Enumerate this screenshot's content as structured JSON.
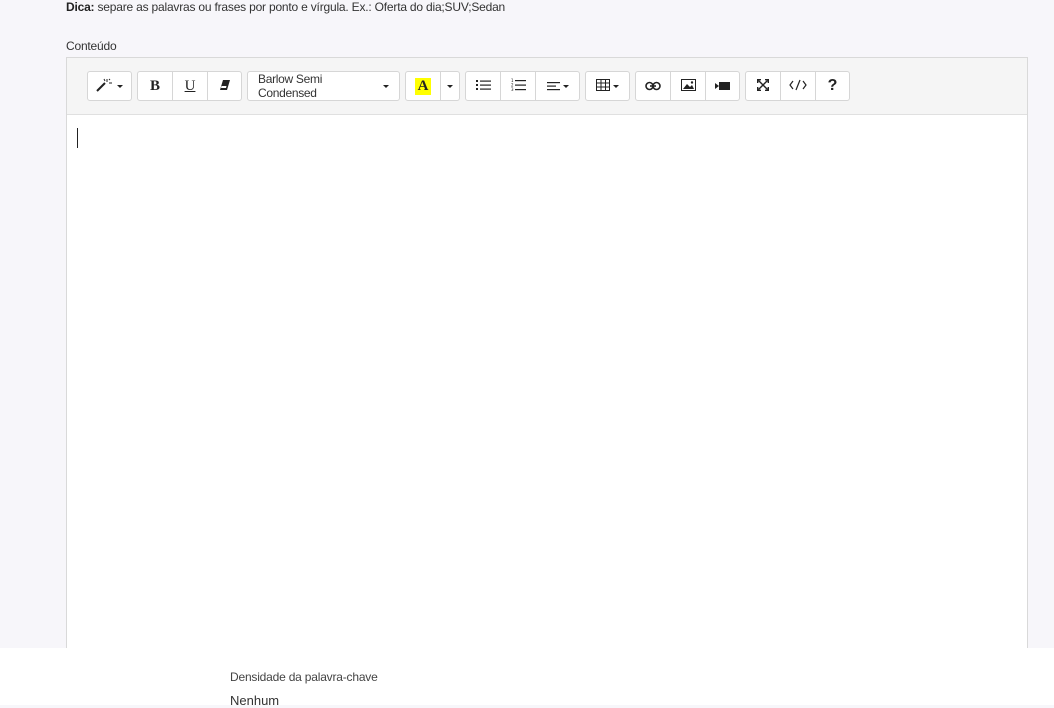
{
  "hint": {
    "label": "Dica:",
    "text": " separe as palavras ou frases por ponto e vírgula. Ex.: Oferta do dia;SUV;Sedan"
  },
  "content": {
    "label": "Conteúdo"
  },
  "toolbar": {
    "font_name": "Barlow Semi Condensed",
    "bold": "B",
    "underline": "U",
    "help": "?"
  },
  "icons": [
    "magic-icon",
    "bold-icon",
    "underline-icon",
    "eraser-icon",
    "font-color-icon",
    "unordered-list-icon",
    "ordered-list-icon",
    "align-icon",
    "table-icon",
    "link-icon",
    "image-icon",
    "video-icon",
    "fullscreen-icon",
    "code-view-icon",
    "help-icon"
  ],
  "colors": {
    "highlight": "#ffff00"
  },
  "keyword_density": {
    "label": "Densidade da palavra-chave",
    "value": "Nenhum"
  }
}
